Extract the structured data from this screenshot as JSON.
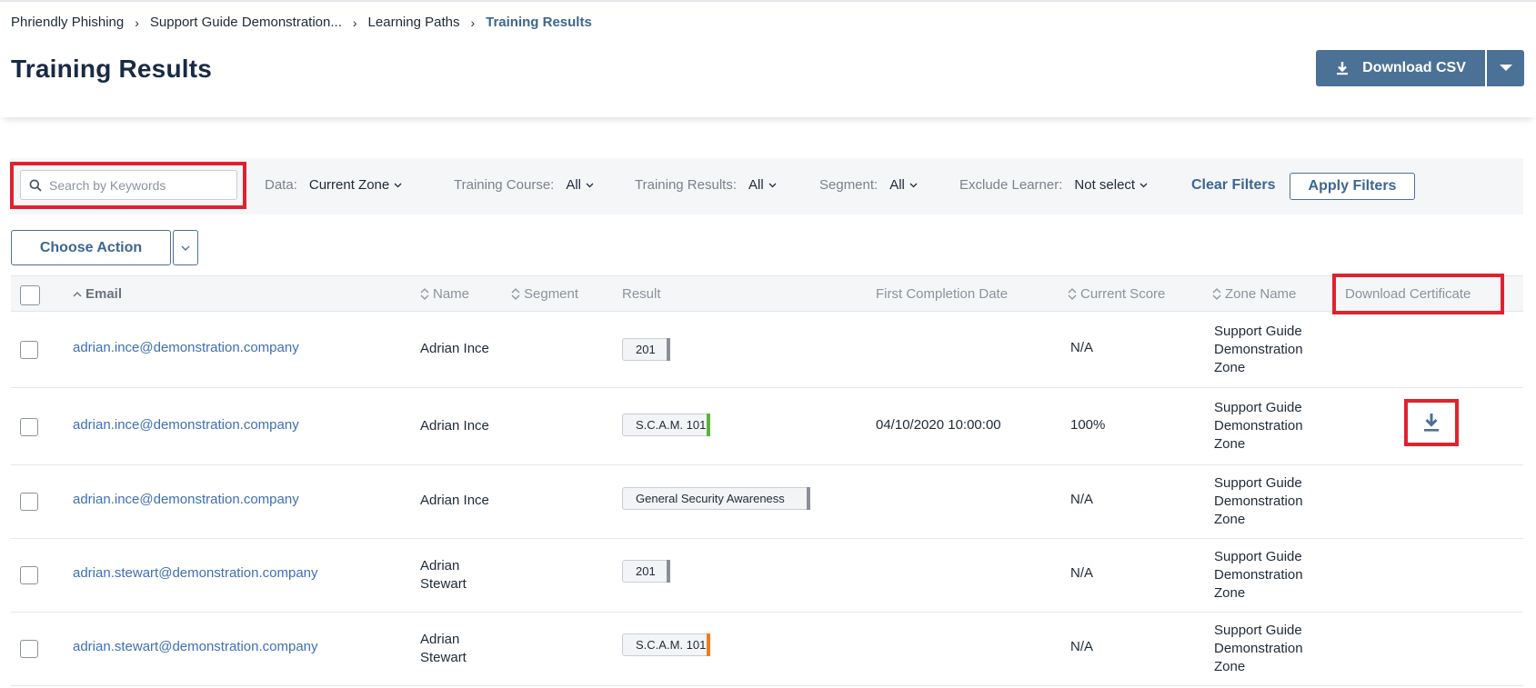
{
  "breadcrumb": [
    {
      "label": "Phriendly Phishing"
    },
    {
      "label": "Support Guide Demonstration..."
    },
    {
      "label": "Learning Paths"
    },
    {
      "label": "Training Results"
    }
  ],
  "page": {
    "title": "Training Results"
  },
  "toolbar": {
    "download_csv_label": "Download CSV"
  },
  "search": {
    "placeholder": "Search by Keywords",
    "value": ""
  },
  "filters": {
    "data": {
      "label": "Data:",
      "value": "Current Zone"
    },
    "training_course": {
      "label": "Training Course:",
      "value": "All"
    },
    "training_results": {
      "label": "Training Results:",
      "value": "All"
    },
    "segment": {
      "label": "Segment:",
      "value": "All"
    },
    "exclude_learner": {
      "label": "Exclude Learner:",
      "value": "Not select"
    },
    "clear_label": "Clear Filters",
    "apply_label": "Apply Filters"
  },
  "actions": {
    "choose_action_label": "Choose Action"
  },
  "table": {
    "columns": {
      "email": "Email",
      "name": "Name",
      "segment": "Segment",
      "result": "Result",
      "first_completion_date": "First Completion Date",
      "current_score": "Current Score",
      "zone_name": "Zone Name",
      "download_certificate": "Download Certificate"
    },
    "rows": [
      {
        "email": "adrian.ince@demonstration.company",
        "name_line1": "Adrian Ince",
        "name_line2": "",
        "result": "201",
        "result_status_color": "#8a8f96",
        "first_completion_date": "",
        "current_score": "N/A",
        "zone": [
          "Support Guide",
          "Demonstration",
          "Zone"
        ]
      },
      {
        "email": "adrian.ince@demonstration.company",
        "name_line1": "Adrian Ince",
        "name_line2": "",
        "result": "S.C.A.M. 101",
        "result_status_color": "#58b53a",
        "first_completion_date": "04/10/2020 10:00:00",
        "current_score": "100%",
        "zone": [
          "Support Guide",
          "Demonstration",
          "Zone"
        ]
      },
      {
        "email": "adrian.ince@demonstration.company",
        "name_line1": "Adrian Ince",
        "name_line2": "",
        "result": "General Security Awareness",
        "result_status_color": "#8a8f96",
        "first_completion_date": "",
        "current_score": "N/A",
        "zone": [
          "Support Guide",
          "Demonstration",
          "Zone"
        ]
      },
      {
        "email": "adrian.stewart@demonstration.company",
        "name_line1": "Adrian",
        "name_line2": "Stewart",
        "result": "201",
        "result_status_color": "#8a8f96",
        "first_completion_date": "",
        "current_score": "N/A",
        "zone": [
          "Support Guide",
          "Demonstration",
          "Zone"
        ]
      },
      {
        "email": "adrian.stewart@demonstration.company",
        "name_line1": "Adrian",
        "name_line2": "Stewart",
        "result": "S.C.A.M. 101",
        "result_status_color": "#f07b1c",
        "first_completion_date": "",
        "current_score": "N/A",
        "zone": [
          "Support Guide",
          "Demonstration",
          "Zone"
        ]
      }
    ]
  },
  "colors": {
    "brand": "#4c7196",
    "link": "#3f6fb5",
    "highlight": "#e0222e"
  }
}
